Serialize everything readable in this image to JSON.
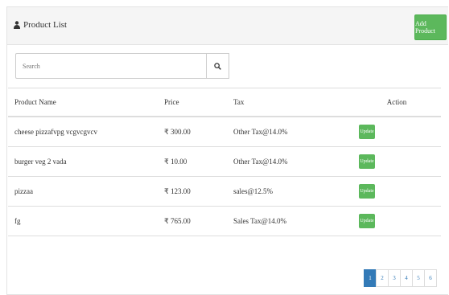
{
  "header": {
    "title": "Product List",
    "add_button_label": "Add Product"
  },
  "search": {
    "placeholder": "Search"
  },
  "table": {
    "columns": [
      "Product Name",
      "Price",
      "Tax",
      "Action"
    ],
    "rows": [
      {
        "name": "cheese pizzafvpg vcgvcgvcv",
        "price": "₹ 300.00",
        "tax": "Other Tax@14.0%",
        "action": "Update"
      },
      {
        "name": "burger veg 2 vada",
        "price": "₹ 10.00",
        "tax": "Other Tax@14.0%",
        "action": "Update"
      },
      {
        "name": "pizzaa",
        "price": "₹ 123.00",
        "tax": "sales@12.5%",
        "action": "Update"
      },
      {
        "name": "fg",
        "price": "₹ 765.00",
        "tax": "Sales Tax@14.0%",
        "action": "Update"
      }
    ]
  },
  "pagination": {
    "pages": [
      "1",
      "2",
      "3",
      "4",
      "5",
      "6"
    ],
    "active": "1"
  },
  "colors": {
    "primary": "#337ab7",
    "success": "#5cb85c",
    "header_bg": "#f5f5f5"
  }
}
